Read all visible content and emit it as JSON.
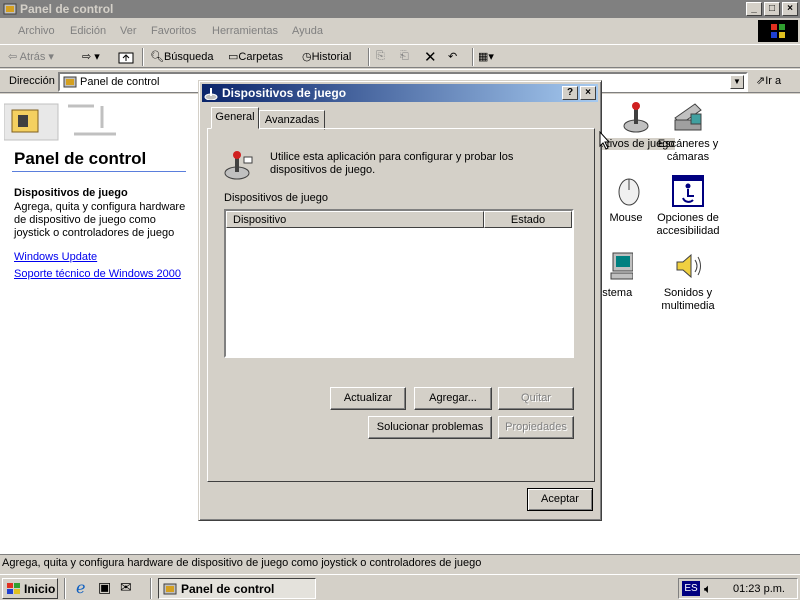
{
  "window": {
    "title": "Panel de control",
    "controls": {
      "minimize": "_",
      "maximize": "□",
      "close": "×"
    }
  },
  "menu": [
    "Archivo",
    "Edición",
    "Ver",
    "Favoritos",
    "Herramientas",
    "Ayuda"
  ],
  "toolbar": {
    "back": "Atrás",
    "search": "Búsqueda",
    "folders": "Carpetas",
    "history": "Historial"
  },
  "address": {
    "label": "Dirección",
    "value": "Panel de control",
    "go": "Ir a"
  },
  "webview": {
    "title": "Panel de control",
    "selected_title": "Dispositivos de juego",
    "selected_desc": "Agrega, quita y configura hardware de dispositivo de juego como joystick o controladores de juego",
    "links": [
      "Windows Update",
      "Soporte técnico de Windows 2000"
    ]
  },
  "icons": [
    {
      "label": "...tivos de juego",
      "icon": "joystick-icon"
    },
    {
      "label": "Escáneres y cámaras",
      "icon": "scanner-icon"
    },
    {
      "label": "Mouse",
      "icon": "mouse-icon"
    },
    {
      "label": "Opciones de accesibilidad",
      "icon": "accessibility-icon"
    },
    {
      "label": "istema",
      "icon": "computer-icon"
    },
    {
      "label": "Sonidos y multimedia",
      "icon": "speaker-icon"
    }
  ],
  "status_text": "Agrega, quita y configura hardware de dispositivo de juego como joystick o controladores de juego",
  "dialog": {
    "title": "Dispositivos de juego",
    "help": "?",
    "close": "×",
    "tabs": [
      "General",
      "Avanzadas"
    ],
    "intro": "Utilice esta aplicación para configurar y probar los dispositivos de juego.",
    "list_label": "Dispositivos de juego",
    "columns": [
      "Dispositivo",
      "Estado"
    ],
    "buttons": {
      "refresh": "Actualizar",
      "add": "Agregar...",
      "remove": "Quitar",
      "troubleshoot": "Solucionar  problemas",
      "properties": "Propiedades",
      "ok": "Aceptar"
    }
  },
  "taskbar": {
    "start": "Inicio",
    "task": "Panel de control",
    "lang": "ES",
    "clock": "01:23 p.m."
  },
  "colors": {
    "title_active_start": "#0a246a",
    "title_active_end": "#a6caf0",
    "title_inactive": "#808080",
    "face": "#d4d0c8",
    "link": "#0000ee"
  }
}
